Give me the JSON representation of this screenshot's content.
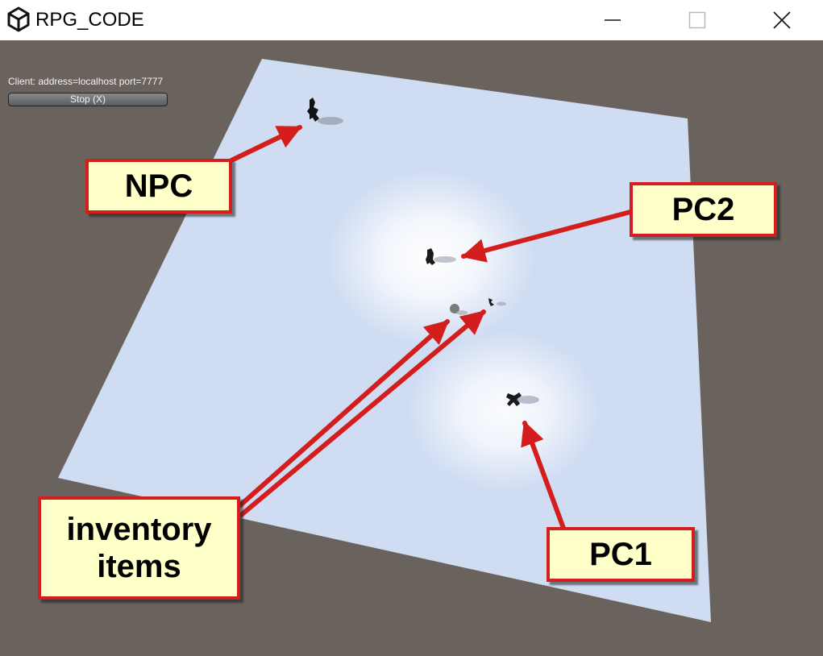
{
  "window": {
    "title": "RPG_CODE"
  },
  "hud": {
    "client_text": "Client: address=localhost port=7777",
    "stop_button_label": "Stop (X)"
  },
  "labels": {
    "npc": "NPC",
    "pc2": "PC2",
    "inventory_line1": "inventory",
    "inventory_line2": "items",
    "pc1": "PC1"
  },
  "colors": {
    "viewport_background": "#6a625d",
    "ground_plane": "#cfdcf2",
    "callout_fill": "#ffffc9",
    "callout_border": "#d41e1e",
    "arrow": "#d41e1e"
  },
  "icons": {
    "app": "unity-logo-icon",
    "minimize": "minimize-icon",
    "maximize": "maximize-icon",
    "close": "close-icon"
  }
}
